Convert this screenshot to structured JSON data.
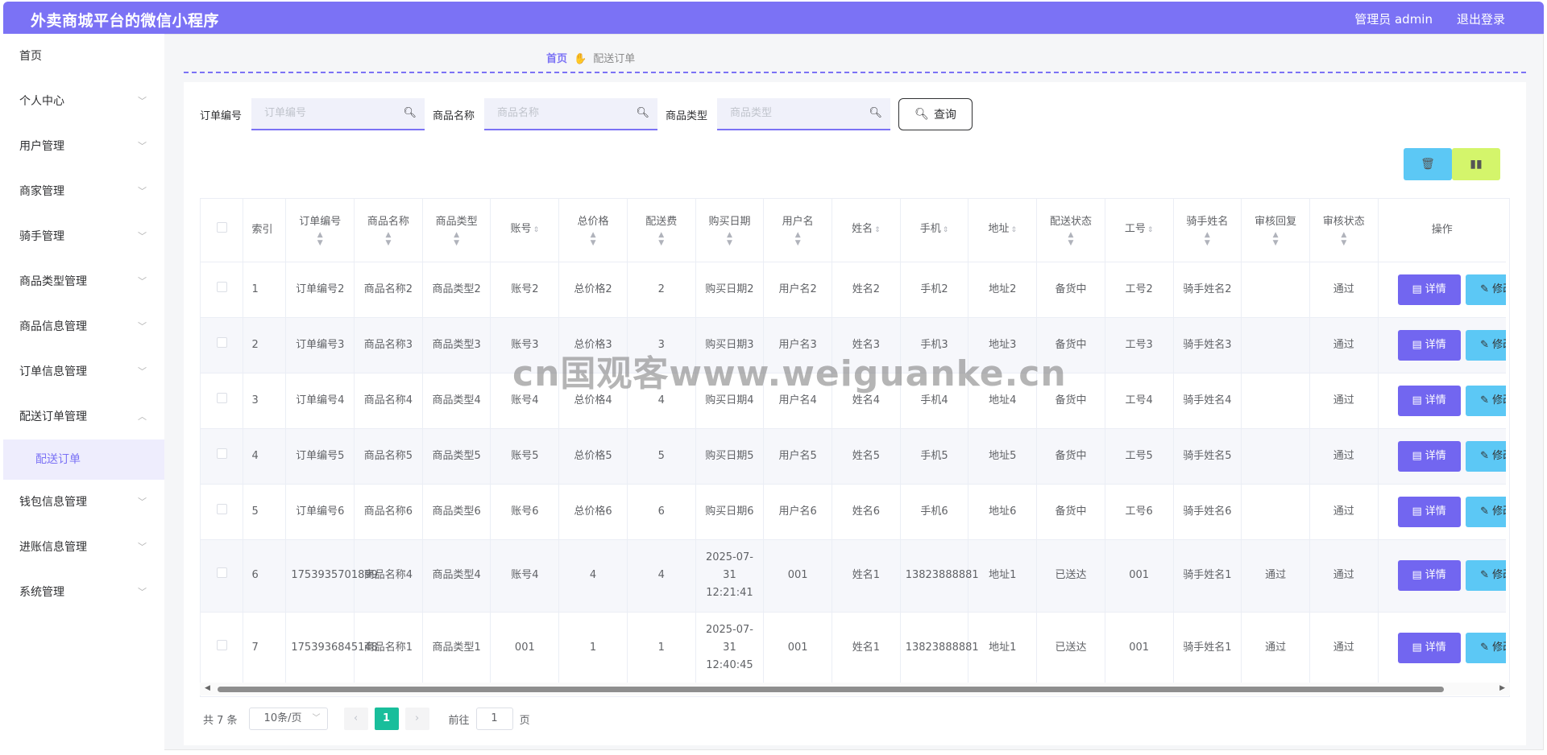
{
  "header": {
    "title": "外卖商城平台的微信小程序",
    "admin": "管理员 admin",
    "logout": "退出登录"
  },
  "sidebar": {
    "home": "首页",
    "items": [
      {
        "label": "个人中心"
      },
      {
        "label": "用户管理"
      },
      {
        "label": "商家管理"
      },
      {
        "label": "骑手管理"
      },
      {
        "label": "商品类型管理"
      },
      {
        "label": "商品信息管理"
      },
      {
        "label": "订单信息管理"
      },
      {
        "label": "配送订单管理"
      },
      {
        "label": "钱包信息管理"
      },
      {
        "label": "进账信息管理"
      },
      {
        "label": "系统管理"
      }
    ],
    "sub_active": "配送订单"
  },
  "breadcrumb": {
    "home": "首页",
    "current": "配送订单"
  },
  "search": {
    "order_label": "订单编号",
    "order_placeholder": "订单编号",
    "goods_label": "商品名称",
    "goods_placeholder": "商品名称",
    "type_label": "商品类型",
    "type_placeholder": "商品类型",
    "query": "查询"
  },
  "table": {
    "headers": [
      "索引",
      "订单编号",
      "商品名称",
      "商品类型",
      "账号",
      "总价格",
      "配送费",
      "购买日期",
      "用户名",
      "姓名",
      "手机",
      "地址",
      "配送状态",
      "工号",
      "骑手姓名",
      "审核回复",
      "审核状态",
      "操作"
    ],
    "rows": [
      [
        "1",
        "订单编号2",
        "商品名称2",
        "商品类型2",
        "账号2",
        "总价格2",
        "2",
        "购买日期2",
        "用户名2",
        "姓名2",
        "手机2",
        "地址2",
        "备货中",
        "工号2",
        "骑手姓名2",
        "",
        "通过"
      ],
      [
        "2",
        "订单编号3",
        "商品名称3",
        "商品类型3",
        "账号3",
        "总价格3",
        "3",
        "购买日期3",
        "用户名3",
        "姓名3",
        "手机3",
        "地址3",
        "备货中",
        "工号3",
        "骑手姓名3",
        "",
        "通过"
      ],
      [
        "3",
        "订单编号4",
        "商品名称4",
        "商品类型4",
        "账号4",
        "总价格4",
        "4",
        "购买日期4",
        "用户名4",
        "姓名4",
        "手机4",
        "地址4",
        "备货中",
        "工号4",
        "骑手姓名4",
        "",
        "通过"
      ],
      [
        "4",
        "订单编号5",
        "商品名称5",
        "商品类型5",
        "账号5",
        "总价格5",
        "5",
        "购买日期5",
        "用户名5",
        "姓名5",
        "手机5",
        "地址5",
        "备货中",
        "工号5",
        "骑手姓名5",
        "",
        "通过"
      ],
      [
        "5",
        "订单编号6",
        "商品名称6",
        "商品类型6",
        "账号6",
        "总价格6",
        "6",
        "购买日期6",
        "用户名6",
        "姓名6",
        "手机6",
        "地址6",
        "备货中",
        "工号6",
        "骑手姓名6",
        "",
        "通过"
      ],
      [
        "6",
        "1753935701899",
        "商品名称4",
        "商品类型4",
        "账号4",
        "4",
        "4",
        "2025-07-31 12:21:41",
        "001",
        "姓名1",
        "13823888881",
        "地址1",
        "已送达",
        "001",
        "骑手姓名1",
        "通过",
        "通过"
      ],
      [
        "7",
        "1753936845148",
        "商品名称1",
        "商品类型1",
        "001",
        "1",
        "1",
        "2025-07-31 12:40:45",
        "001",
        "姓名1",
        "13823888881",
        "地址1",
        "已送达",
        "001",
        "骑手姓名1",
        "通过",
        "通过"
      ]
    ],
    "actions": {
      "detail": "详情",
      "edit": "修改",
      "delete": "删"
    }
  },
  "pagination": {
    "total": "共 7 条",
    "page_size": "10条/页",
    "current": "1",
    "goto_prefix": "前往",
    "goto_value": "1",
    "goto_suffix": "页"
  },
  "watermark": "cn国观客www.weiguanke.cn",
  "colors": {
    "header": "#7b72f5",
    "detail": "#7266f0",
    "edit": "#5cc8f5",
    "delete": "#d4f56b",
    "page_active": "#19be9b"
  }
}
